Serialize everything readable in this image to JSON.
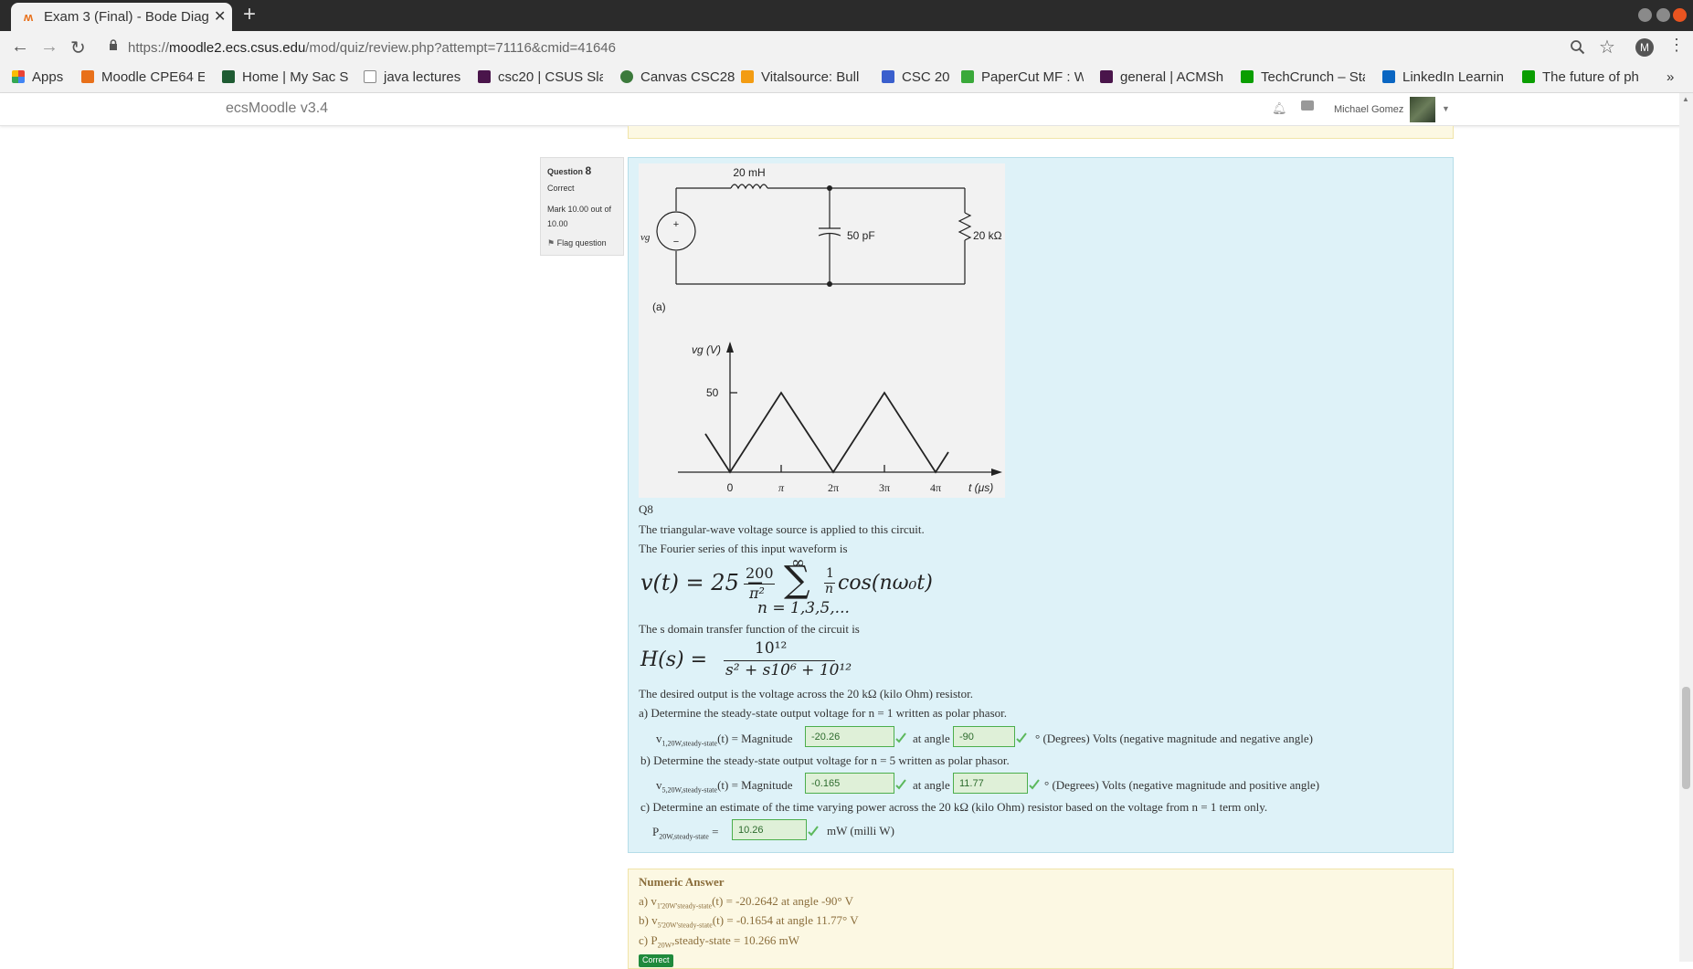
{
  "browser": {
    "tab_title": "Exam 3 (Final) - Bode Diag",
    "url_prefix": "https://",
    "url_host": "moodle2.ecs.csus.edu",
    "url_path": "/mod/quiz/review.php?attempt=71116&cmid=41646",
    "profile_initial": "M",
    "bookmarks": [
      {
        "label": "Apps",
        "color": "#4285f4"
      },
      {
        "label": "Moodle CPE64 E",
        "color": "#e8701a"
      },
      {
        "label": "Home | My Sac St",
        "color": "#1e5b32"
      },
      {
        "label": "java lectures",
        "color": "#888888"
      },
      {
        "label": "csc20 | CSUS Slac",
        "color": "#4a154b"
      },
      {
        "label": "Canvas CSC28",
        "color": "#3c7a3c"
      },
      {
        "label": "Vitalsource: Bull",
        "color": "#f39c12"
      },
      {
        "label": "CSC 20",
        "color": "#3a5fcd"
      },
      {
        "label": "PaperCut MF : W",
        "color": "#3aa93a"
      },
      {
        "label": "general | ACMSh",
        "color": "#4a154b"
      },
      {
        "label": "TechCrunch – Sta",
        "color": "#0a9e01"
      },
      {
        "label": "LinkedIn Learnin",
        "color": "#0a66c2"
      },
      {
        "label": "The future of ph",
        "color": "#0a9e01"
      }
    ],
    "overflow": "»"
  },
  "moodle": {
    "site_name": "ecsMoodle v3.4",
    "user_name": "Michael Gomez"
  },
  "question": {
    "label": "Question",
    "number": "8",
    "status": "Correct",
    "mark": "Mark 10.00 out of 10.00",
    "flag": "Flag question",
    "q_id": "Q8",
    "line1": "The triangular-wave voltage source is applied to this circuit.",
    "line2": "The Fourier series of this input waveform is",
    "line3": "The s domain transfer function of the circuit is",
    "line4": "The desired output is the voltage across the 20 kΩ (kilo Ohm) resistor.",
    "part_a": "a) Determine the steady-state output voltage for n = 1 written as polar phasor.",
    "part_b": "b) Determine the steady-state output voltage for n = 5 written as polar phasor.",
    "part_c": "c) Determine an estimate of the time varying power across the 20 kΩ (kilo Ohm) resistor based on the voltage from n = 1 term only.",
    "a_lhs_v": "v",
    "a_lhs_sub": "1,20W,steady-state",
    "b_lhs_sub": "5,20W,steady-state",
    "lhs_rest": "(t) = Magnitude",
    "at_angle": "at angle",
    "a_mag": "-20.26",
    "a_angle": "-90",
    "a_units": "° (Degrees) Volts  (negative magnitude and negative angle)",
    "b_mag": "-0.165",
    "b_angle": "11.77",
    "b_units": "° (Degrees) Volts  (negative magnitude and positive angle)",
    "c_lhs_p": "P",
    "c_lhs_sub": "20W,steady-state",
    "c_eq": "=",
    "c_val": "10.26",
    "c_units": "mW  (milli W)"
  },
  "figure": {
    "L": "20 mH",
    "C": "50 pF",
    "R": "20 kΩ",
    "src": "vg",
    "label_a": "(a)",
    "ylabel": "vg (V)",
    "ytick": "50",
    "xticks": [
      "0",
      "π",
      "2π",
      "3π",
      "4π"
    ],
    "xlabel": "t (μs)"
  },
  "formula": {
    "v_lhs": "v(t) = 25 −",
    "num": "200",
    "den": "π²",
    "sum_top": "∞",
    "sum_bot": "n = 1,3,5,...",
    "frac_n_num": "1",
    "frac_n_den": "n",
    "cos": "cos(nω₀t)",
    "h_lhs": "H(s) =",
    "h_num": "10¹²",
    "h_den": "s² + s10⁶ + 10¹²"
  },
  "numeric_answer": {
    "title": "Numeric Answer",
    "a": "a)  v",
    "a_sub": "1'20W'steady-state",
    "a_rest": "(t) = -20.2642 at angle -90° V",
    "b": "b)  v",
    "b_sub": "5'20W'steady-state",
    "b_rest": "(t) = -0.1654 at angle 11.77° V",
    "c": "c)  P",
    "c_sub": "20W",
    "c_rest": ",steady-state = 10.266 mW",
    "badge": "Correct"
  }
}
